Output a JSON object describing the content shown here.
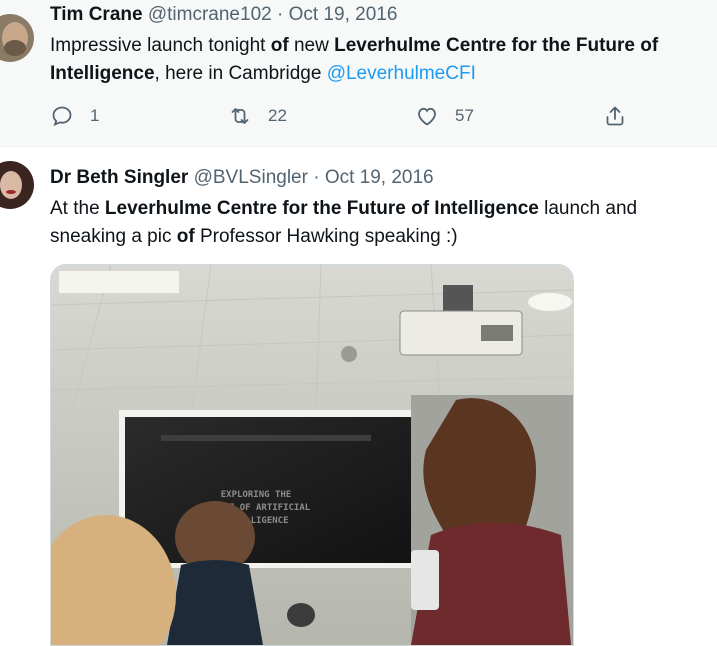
{
  "tweets": [
    {
      "author_name": "Tim Crane",
      "handle": "@timcrane102",
      "separator": "·",
      "date": "Oct 19, 2016",
      "text": {
        "p1": "Impressive launch tonight ",
        "b1": "of",
        "p2": " new ",
        "b2": "Leverhulme Centre for the Future of Intelligence",
        "p3": ", here in Cambridge ",
        "mention": "@LeverhulmeCFI"
      },
      "stats": {
        "replies": "1",
        "retweets": "22",
        "likes": "57"
      },
      "icons": [
        "reply-icon",
        "retweet-icon",
        "like-icon",
        "share-icon"
      ]
    },
    {
      "author_name": "Dr Beth Singler",
      "handle": "@BVLSingler",
      "separator": "·",
      "date": "Oct 19, 2016",
      "text": {
        "p1": "At the ",
        "b1": "Leverhulme Centre for the Future of Intelligence",
        "p2": " launch and sneaking a pic ",
        "b2": "of",
        "p3": " Professor Hawking speaking :)"
      },
      "media": {
        "slide_line1": "EXPLORING THE",
        "slide_line2": "IMPACT OF ARTIFICIAL",
        "slide_line3": "INTELLIGENCE"
      }
    }
  ],
  "colors": {
    "text": "#0f1419",
    "secondary": "#536471",
    "link": "#1d9bf0",
    "highlight_bg": "#f7f9f9"
  }
}
